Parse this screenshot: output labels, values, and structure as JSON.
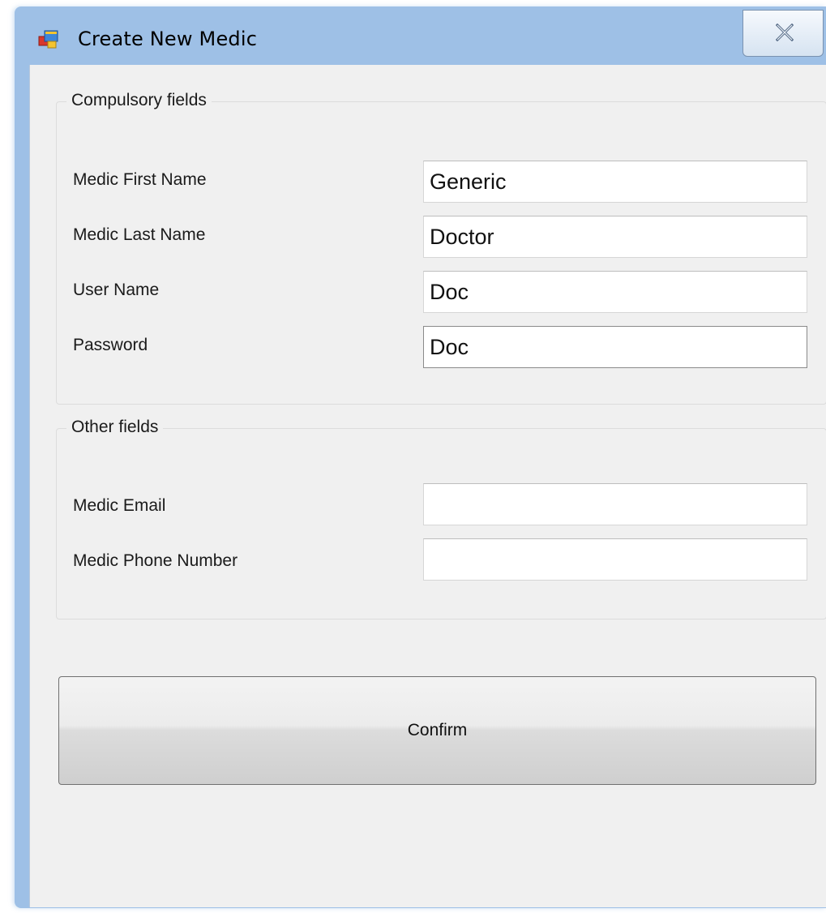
{
  "window": {
    "title": "Create New Medic",
    "icon": "application-window-icon",
    "close_icon": "close-icon"
  },
  "compulsory_group": {
    "legend": "Compulsory fields",
    "first_name": {
      "label": "Medic First Name",
      "value": "Generic"
    },
    "last_name": {
      "label": "Medic Last Name",
      "value": "Doctor"
    },
    "user_name": {
      "label": "User Name",
      "value": "Doc"
    },
    "password": {
      "label": "Password",
      "value": "Doc"
    }
  },
  "other_group": {
    "legend": "Other fields",
    "email": {
      "label": "Medic Email",
      "value": ""
    },
    "phone": {
      "label": "Medic Phone Number",
      "value": ""
    }
  },
  "confirm_button": {
    "label": "Confirm"
  },
  "colors": {
    "titlebar": "#9ec0e6",
    "client_bg": "#f0f0f0",
    "input_bg": "#ffffff"
  }
}
